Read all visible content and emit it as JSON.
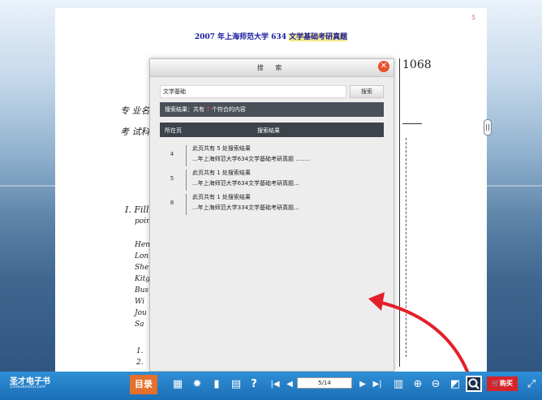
{
  "page": {
    "title_prefix": "2007 年上海师范大学 634 ",
    "title_highlight": "文学基础考研真题",
    "page_number": "5",
    "scan_code": "1068",
    "handwriting": [
      "专 业名",
      "考 试科",
      "I. Fill",
      "poin",
      "Hen",
      "Lon",
      "She",
      "Kitg",
      "Bus",
      "Wi",
      "Jou",
      "Sa",
      "1.",
      "2."
    ]
  },
  "dialog": {
    "title": "搜 索",
    "close_glyph": "✕",
    "search_value": "文学基础",
    "search_button": "搜索",
    "summary_prefix": "搜索结果：共有 ",
    "summary_count": "7",
    "summary_suffix": " 个符合的内容",
    "col_page": "所在页",
    "col_result": "搜索结果",
    "results": [
      {
        "page": "4",
        "line1": "此页共有 5 处搜索结果",
        "line2": "...年上海师范大学634文学基础考研真题 ........"
      },
      {
        "page": "5",
        "line1": "此页共有 1 处搜索结果",
        "line2": "...年上海师范大学634文学基础考研真题..."
      },
      {
        "page": "8",
        "line1": "此页共有 1 处搜索结果",
        "line2": "...年上海师范大学334文学基础考研真题..."
      }
    ]
  },
  "side_toggle": "||",
  "toolbar": {
    "logo_main": "圣才电子书",
    "logo_sub": "100xuexishu.com",
    "toc_label": "目录",
    "page_indicator": "5/14",
    "buy_label": "购买",
    "icons": [
      "thumbnails-icon",
      "settings-icon",
      "bookmark-icon",
      "note-icon",
      "help-icon",
      "first-page-icon",
      "prev-page-icon",
      "next-page-icon",
      "last-page-icon",
      "double-page-icon",
      "zoom-in-icon",
      "zoom-out-icon",
      "fullscreen-toggle-icon",
      "search-icon",
      "cart-icon",
      "expand-icon"
    ]
  },
  "colors": {
    "toolbar": "#1f78c0",
    "toc_button": "#e4702b",
    "buy_button": "#d6232a",
    "close_button": "#e5532a",
    "arrow": "#e3202a",
    "summary_bar": "#4a5058"
  }
}
